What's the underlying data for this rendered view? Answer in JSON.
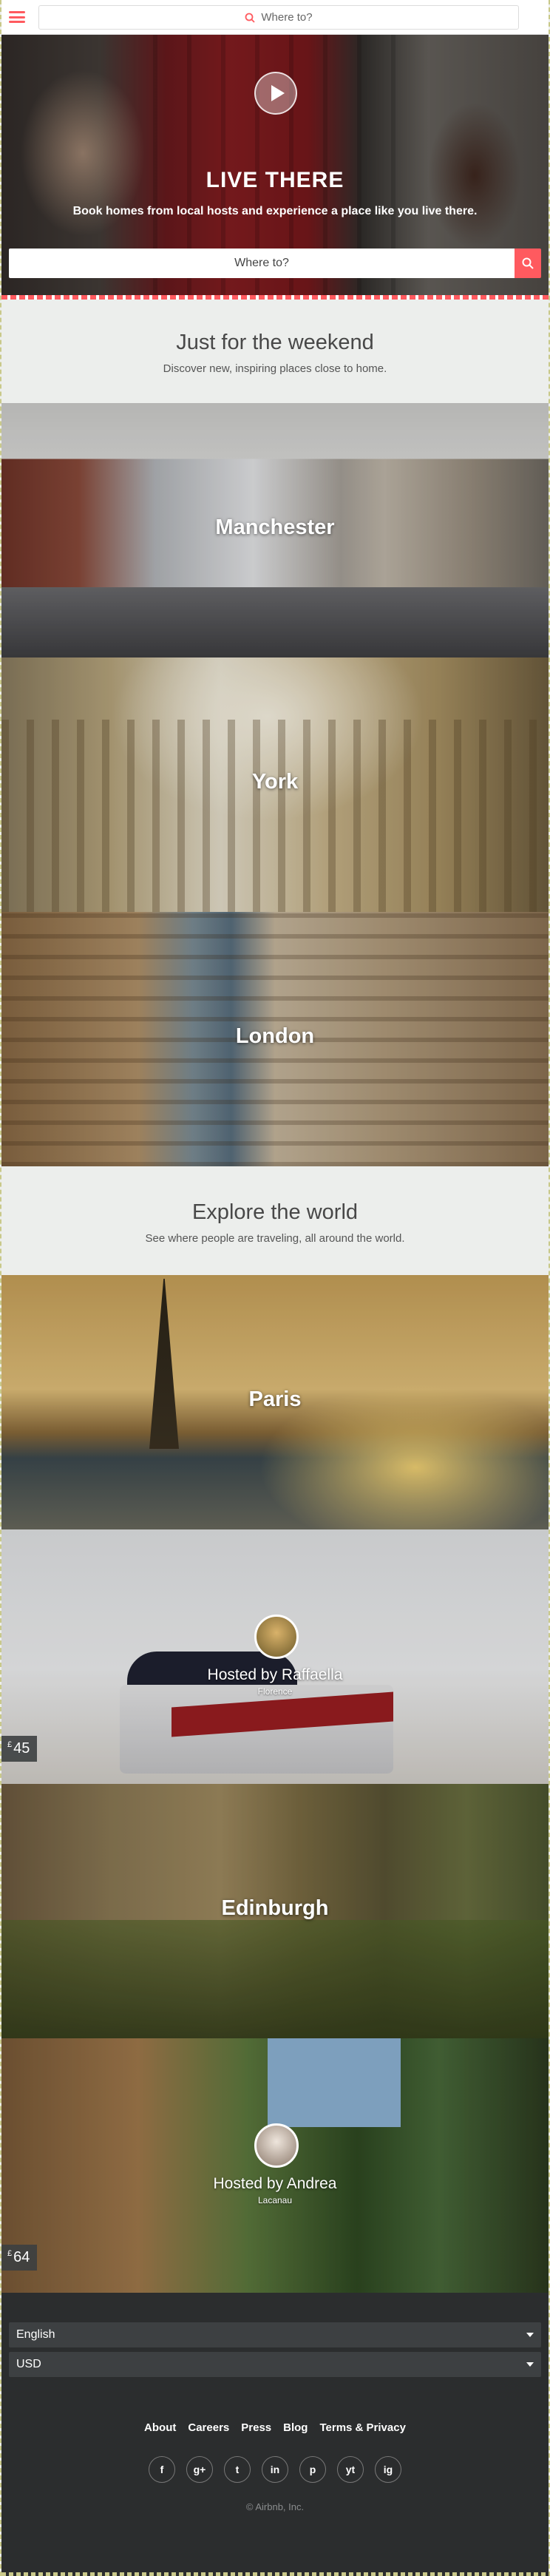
{
  "nav": {
    "search_placeholder": "Where to?"
  },
  "hero": {
    "title": "LIVE THERE",
    "subtitle": "Book homes from local hosts and experience a place like you live there.",
    "search_placeholder": "Where to?"
  },
  "weekend": {
    "title": "Just for the weekend",
    "subtitle": "Discover new, inspiring places close to home.",
    "cities": [
      "Manchester",
      "York",
      "London"
    ]
  },
  "explore": {
    "title": "Explore the world",
    "subtitle": "See where people are traveling, all around the world.",
    "paris": "Paris",
    "listing1": {
      "host": "Hosted by Raffaella",
      "city": "Florence",
      "currency": "£",
      "price": "45"
    },
    "edinburgh": "Edinburgh",
    "listing2": {
      "host": "Hosted by Andrea",
      "city": "Lacanau",
      "currency": "£",
      "price": "64"
    }
  },
  "footer": {
    "language": "English",
    "currency": "USD",
    "links": [
      "About",
      "Careers",
      "Press",
      "Blog",
      "Terms & Privacy"
    ],
    "socials": [
      "f",
      "g+",
      "t",
      "in",
      "p",
      "yt",
      "ig"
    ],
    "copyright": "© Airbnb, Inc."
  },
  "colors": {
    "brand": "#ff5a5f",
    "footer_bg": "#2b2d2e"
  }
}
